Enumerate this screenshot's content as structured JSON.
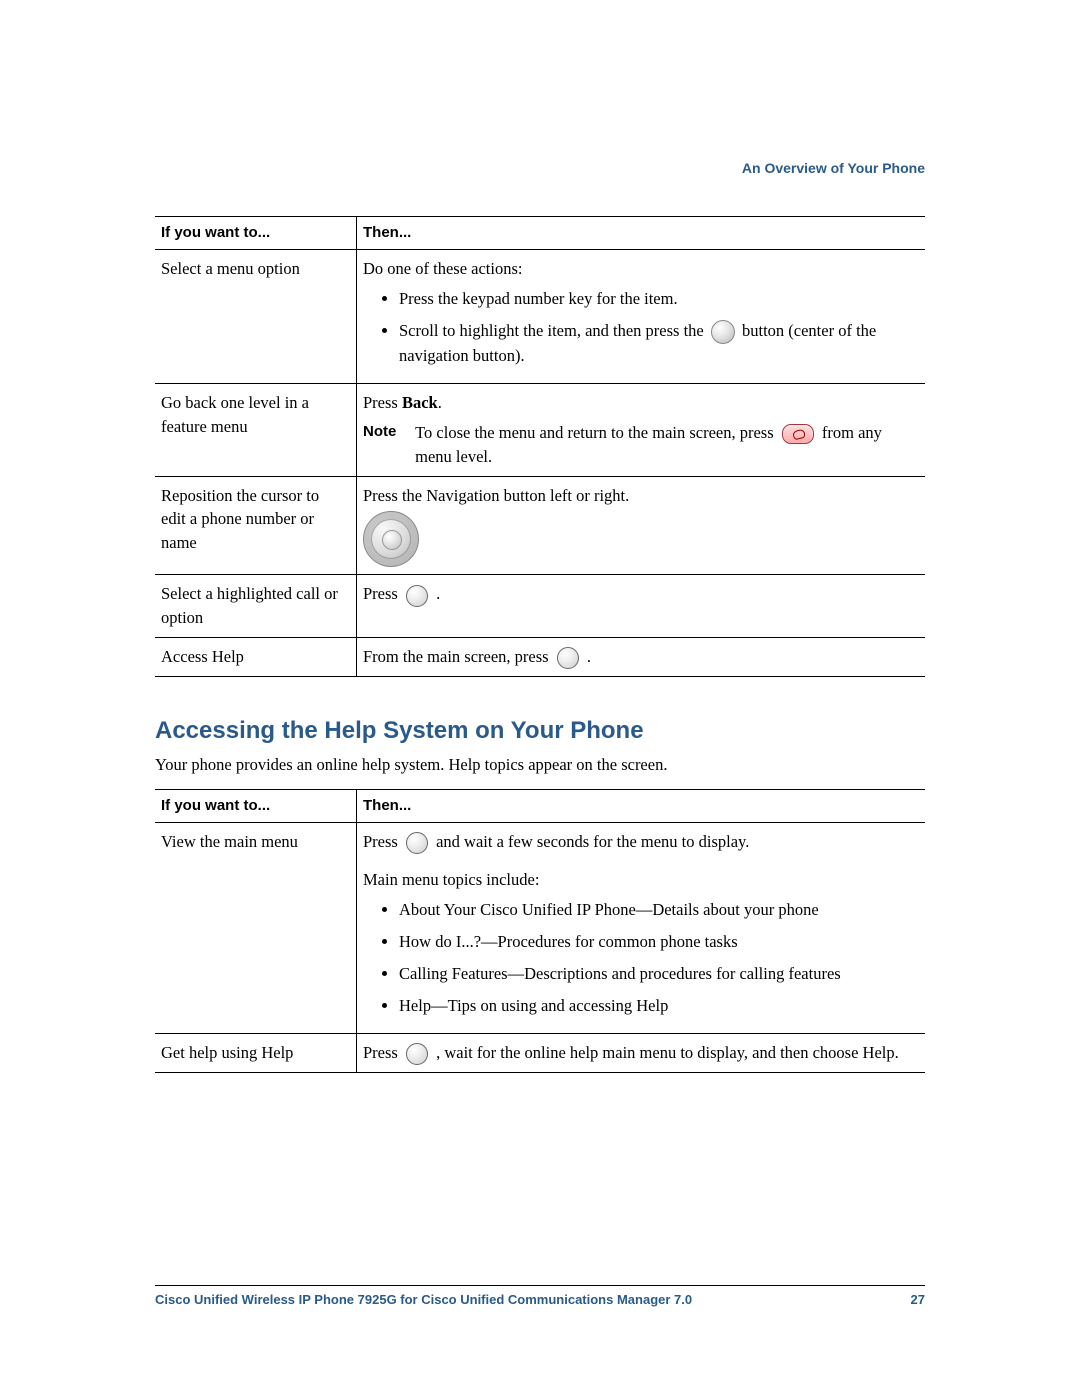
{
  "chapter_header": "An Overview of Your Phone",
  "table1": {
    "headers": {
      "col1": "If you want to...",
      "col2": "Then..."
    },
    "rows": [
      {
        "col1": "Select a menu option",
        "lead": "Do one of these actions:",
        "b1": "Press the keypad number key for the item.",
        "b2a": "Scroll to highlight the item, and then press the ",
        "b2b": " button (center of the navigation button)."
      },
      {
        "col1a": "Go back one level in a feature menu",
        "press": "Press ",
        "back": "Back",
        "dot": ".",
        "note_label": "Note",
        "note_a": "To close the menu and return to the main screen, press ",
        "note_b": " from any menu level."
      },
      {
        "col1": "Reposition the cursor to edit a phone number or name",
        "text": "Press the Navigation button left or right."
      },
      {
        "col1": "Select a highlighted call or option",
        "press": "Press ",
        "dot": "."
      },
      {
        "col1": "Access Help",
        "text": "From the main screen, press ",
        "dot": "."
      }
    ]
  },
  "section_heading": "Accessing the Help System on Your Phone",
  "section_intro": "Your phone provides an online help system. Help topics appear on the screen.",
  "table2": {
    "headers": {
      "col1": "If you want to...",
      "col2": "Then..."
    },
    "rows": [
      {
        "col1": "View the main menu",
        "press": "Press ",
        "after": " and wait a few seconds for the menu to display.",
        "topics_lead": "Main menu topics include:",
        "b1": "About Your Cisco Unified IP Phone—Details about your phone",
        "b2": "How do I...?—Procedures for common phone tasks",
        "b3": "Calling Features—Descriptions and procedures for calling features",
        "b4": "Help—Tips on using and accessing Help"
      },
      {
        "col1": "Get help using Help",
        "press": "Press ",
        "after": ", wait for the online help main menu to display, and then choose Help."
      }
    ]
  },
  "footer": {
    "title": "Cisco Unified Wireless IP Phone 7925G for Cisco Unified Communications Manager 7.0",
    "page": "27"
  }
}
